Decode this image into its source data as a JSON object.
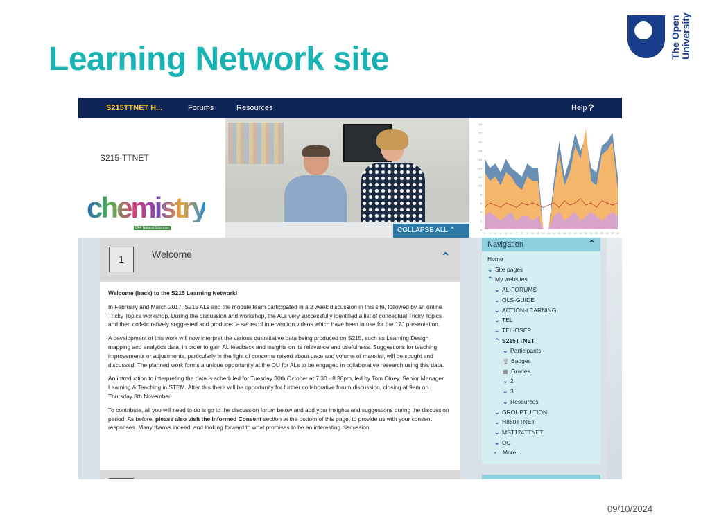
{
  "slide": {
    "title": "Learning Network site",
    "date": "09/10/2024",
    "logo": {
      "line1": "The Open",
      "line2": "University"
    }
  },
  "navbar": {
    "site_name": "S215TTNET H...",
    "items": [
      "Forums",
      "Resources"
    ],
    "help_label": "Help",
    "help_icon": "?"
  },
  "banner": {
    "module_code": "S215-TTNET",
    "logo_text": "chemistry",
    "logo_subtext": "Q64 Natural Sciences",
    "collapse_label": "COLLAPSE ALL",
    "collapse_icon": "^"
  },
  "chart_data": {
    "type": "area",
    "title": "",
    "xlabel": "",
    "ylabel": "",
    "ylim": [
      0,
      24
    ],
    "yticks": [
      0,
      2,
      4,
      6,
      8,
      10,
      12,
      14,
      16,
      18,
      20,
      22,
      24
    ],
    "x": [
      "1",
      "2",
      "3",
      "4",
      "5",
      "6",
      "7",
      "8",
      "9",
      "10",
      "11",
      "12",
      "13",
      "14",
      "15",
      "16",
      "17",
      "18",
      "19",
      "20",
      "21",
      "22",
      "23",
      "24",
      "25",
      "26"
    ],
    "series": [
      {
        "name": "blue",
        "color": "#6a8fb5",
        "values": [
          16,
          14,
          15,
          13,
          16,
          14,
          13,
          12,
          15,
          14,
          14,
          0,
          0,
          11,
          20,
          12,
          16,
          22,
          18,
          21,
          14,
          13,
          19,
          20,
          22,
          12
        ]
      },
      {
        "name": "orange",
        "color": "#f4b66a",
        "values": [
          13,
          11,
          12,
          10,
          13,
          12,
          10,
          9,
          12,
          11,
          11,
          0,
          0,
          9,
          17,
          10,
          13,
          19,
          16,
          23,
          11,
          10,
          17,
          18,
          20,
          9
        ]
      },
      {
        "name": "pink",
        "color": "#d8a3c8",
        "values": [
          3,
          4,
          3,
          2,
          3,
          4,
          2,
          3,
          3,
          2,
          3,
          0,
          0,
          3,
          4,
          2,
          3,
          4,
          2,
          3,
          4,
          3,
          2,
          3,
          4,
          3
        ]
      },
      {
        "name": "line",
        "color": "#c0392b",
        "values": [
          5,
          6,
          5.5,
          5,
          6,
          5.5,
          5,
          6,
          5.5,
          6,
          5.5,
          5,
          5.5,
          6,
          5,
          6.5,
          5.5,
          6,
          7,
          5.5,
          6,
          5,
          6.5,
          6,
          5.5,
          6
        ]
      }
    ]
  },
  "section": {
    "number": "1",
    "title": "Welcome",
    "heading": "Welcome (back) to the S215 Learning Network!",
    "paragraphs": [
      "In February and March 2017, S215 ALs and the module team participated in a 2 week discussion in this site, followed by an online Tricky Topics workshop. During the discussion and workshop, the ALs very successfully identified a list of conceptual Tricky Topics and then collaboratively suggested and produced a series of intervention videos which have been in use for the 17J presentation.",
      "A development of this work will now interpret the various quantitative data being produced on S215, such as Learning Design mapping and analytics data, in order to gain AL feedback and insights on its relevance and usefulness. Suggestions for teaching improvements or adjustments, particularly in the light of concerns raised about pace and volume of material, will be sought and discussed. The planned work forms a unique opportunity at the OU for ALs to be engaged in collaborative research using this data.",
      "An introduction to interpreting the data is scheduled for Tuesday 30th October at 7.30 - 8.30pm, led by Tom Olney, Senior Manager Learning & Teaching in STEM. After this there will be opportunity for further collaborative forum discussion, closing at 9am on Thursday 8th November."
    ],
    "last_paragraph": {
      "before": "To contribute, all you will need to do is go to the discussion forum below and add your insights and suggestions during the discussion period. As before, ",
      "bold": "please also visit the Informed Consent",
      "after": " section at the bottom of this page, to provide us with your consent responses. Many thanks indeed, and looking forward to what promises to be an interesting discussion."
    }
  },
  "navigation": {
    "title": "Navigation",
    "items": [
      {
        "label": "Home",
        "level": 0,
        "chev": "",
        "icon": ""
      },
      {
        "label": "Site pages",
        "level": 0,
        "chev": "v",
        "icon": ""
      },
      {
        "label": "My websites",
        "level": 0,
        "chev": "^",
        "icon": ""
      },
      {
        "label": "AL-FORUMS",
        "level": 1,
        "chev": "v",
        "icon": ""
      },
      {
        "label": "OLS-GUIDE",
        "level": 1,
        "chev": "v",
        "icon": ""
      },
      {
        "label": "ACTION-LEARNING",
        "level": 1,
        "chev": "v",
        "icon": ""
      },
      {
        "label": "TEL",
        "level": 1,
        "chev": "v",
        "icon": ""
      },
      {
        "label": "TEL-OSEP",
        "level": 1,
        "chev": "v",
        "icon": ""
      },
      {
        "label": "S215TTNET",
        "level": 1,
        "chev": "^",
        "icon": "",
        "current": true
      },
      {
        "label": "Participants",
        "level": 2,
        "chev": "v",
        "icon": ""
      },
      {
        "label": "Badges",
        "level": 2,
        "chev": "",
        "icon": "trophy"
      },
      {
        "label": "Grades",
        "level": 2,
        "chev": "",
        "icon": "grades"
      },
      {
        "label": "2",
        "level": 2,
        "chev": "v",
        "icon": ""
      },
      {
        "label": "3",
        "level": 2,
        "chev": "v",
        "icon": ""
      },
      {
        "label": "Resources",
        "level": 2,
        "chev": "v",
        "icon": ""
      },
      {
        "label": "GROUPTUITION",
        "level": 1,
        "chev": "v",
        "icon": ""
      },
      {
        "label": "H880TTNET",
        "level": 1,
        "chev": "v",
        "icon": ""
      },
      {
        "label": "MST124TTNET",
        "level": 1,
        "chev": "v",
        "icon": ""
      },
      {
        "label": "OC",
        "level": 1,
        "chev": "v",
        "icon": ""
      },
      {
        "label": "More...",
        "level": 1,
        "chev": "",
        "icon": "bullet"
      }
    ]
  }
}
